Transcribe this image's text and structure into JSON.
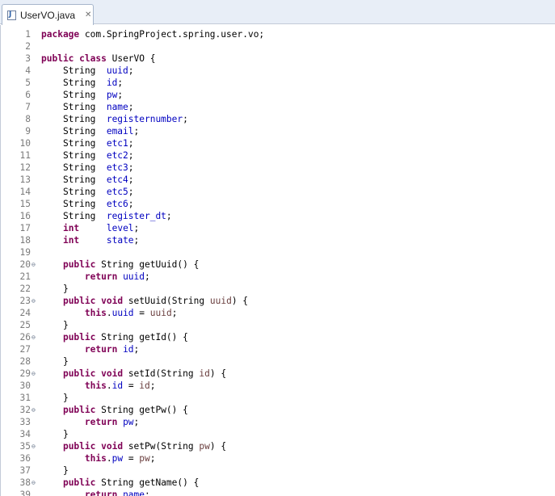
{
  "tab": {
    "title": "UserVO.java",
    "close_glyph": "✕",
    "file_type_icon": "java-file-icon"
  },
  "colors": {
    "keyword": "#7f0055",
    "field": "#0000c0",
    "parameter": "#6a3e3e",
    "text": "#000000",
    "line_number": "#7b7b7b"
  },
  "lines": [
    {
      "n": "1",
      "fold": false,
      "t": [
        [
          "k",
          "package"
        ],
        [
          "p",
          " com.SpringProject.spring.user.vo;"
        ]
      ]
    },
    {
      "n": "2",
      "fold": false,
      "t": []
    },
    {
      "n": "3",
      "fold": false,
      "t": [
        [
          "k",
          "public"
        ],
        [
          "p",
          " "
        ],
        [
          "k",
          "class"
        ],
        [
          "p",
          " UserVO {"
        ]
      ]
    },
    {
      "n": "4",
      "fold": false,
      "t": [
        [
          "p",
          "    String  "
        ],
        [
          "f",
          "uuid"
        ],
        [
          "p",
          ";"
        ]
      ]
    },
    {
      "n": "5",
      "fold": false,
      "t": [
        [
          "p",
          "    String  "
        ],
        [
          "f",
          "id"
        ],
        [
          "p",
          ";"
        ]
      ]
    },
    {
      "n": "6",
      "fold": false,
      "t": [
        [
          "p",
          "    String  "
        ],
        [
          "f",
          "pw"
        ],
        [
          "p",
          ";"
        ]
      ]
    },
    {
      "n": "7",
      "fold": false,
      "t": [
        [
          "p",
          "    String  "
        ],
        [
          "f",
          "name"
        ],
        [
          "p",
          ";"
        ]
      ]
    },
    {
      "n": "8",
      "fold": false,
      "t": [
        [
          "p",
          "    String  "
        ],
        [
          "f",
          "registernumber"
        ],
        [
          "p",
          ";"
        ]
      ]
    },
    {
      "n": "9",
      "fold": false,
      "t": [
        [
          "p",
          "    String  "
        ],
        [
          "f",
          "email"
        ],
        [
          "p",
          ";"
        ]
      ]
    },
    {
      "n": "10",
      "fold": false,
      "t": [
        [
          "p",
          "    String  "
        ],
        [
          "f",
          "etc1"
        ],
        [
          "p",
          ";"
        ]
      ]
    },
    {
      "n": "11",
      "fold": false,
      "t": [
        [
          "p",
          "    String  "
        ],
        [
          "f",
          "etc2"
        ],
        [
          "p",
          ";"
        ]
      ]
    },
    {
      "n": "12",
      "fold": false,
      "t": [
        [
          "p",
          "    String  "
        ],
        [
          "f",
          "etc3"
        ],
        [
          "p",
          ";"
        ]
      ]
    },
    {
      "n": "13",
      "fold": false,
      "t": [
        [
          "p",
          "    String  "
        ],
        [
          "f",
          "etc4"
        ],
        [
          "p",
          ";"
        ]
      ]
    },
    {
      "n": "14",
      "fold": false,
      "t": [
        [
          "p",
          "    String  "
        ],
        [
          "f",
          "etc5"
        ],
        [
          "p",
          ";"
        ]
      ]
    },
    {
      "n": "15",
      "fold": false,
      "t": [
        [
          "p",
          "    String  "
        ],
        [
          "f",
          "etc6"
        ],
        [
          "p",
          ";"
        ]
      ]
    },
    {
      "n": "16",
      "fold": false,
      "t": [
        [
          "p",
          "    String  "
        ],
        [
          "f",
          "register_dt"
        ],
        [
          "p",
          ";"
        ]
      ]
    },
    {
      "n": "17",
      "fold": false,
      "t": [
        [
          "p",
          "    "
        ],
        [
          "k",
          "int"
        ],
        [
          "p",
          "     "
        ],
        [
          "f",
          "level"
        ],
        [
          "p",
          ";"
        ]
      ]
    },
    {
      "n": "18",
      "fold": false,
      "t": [
        [
          "p",
          "    "
        ],
        [
          "k",
          "int"
        ],
        [
          "p",
          "     "
        ],
        [
          "f",
          "state"
        ],
        [
          "p",
          ";"
        ]
      ]
    },
    {
      "n": "19",
      "fold": false,
      "t": []
    },
    {
      "n": "20",
      "fold": true,
      "t": [
        [
          "p",
          "    "
        ],
        [
          "k",
          "public"
        ],
        [
          "p",
          " String getUuid() {"
        ]
      ]
    },
    {
      "n": "21",
      "fold": false,
      "t": [
        [
          "p",
          "        "
        ],
        [
          "k",
          "return"
        ],
        [
          "p",
          " "
        ],
        [
          "f",
          "uuid"
        ],
        [
          "p",
          ";"
        ]
      ]
    },
    {
      "n": "22",
      "fold": false,
      "t": [
        [
          "p",
          "    }"
        ]
      ]
    },
    {
      "n": "23",
      "fold": true,
      "t": [
        [
          "p",
          "    "
        ],
        [
          "k",
          "public"
        ],
        [
          "p",
          " "
        ],
        [
          "k",
          "void"
        ],
        [
          "p",
          " setUuid(String "
        ],
        [
          "a",
          "uuid"
        ],
        [
          "p",
          ") {"
        ]
      ]
    },
    {
      "n": "24",
      "fold": false,
      "t": [
        [
          "p",
          "        "
        ],
        [
          "k",
          "this"
        ],
        [
          "p",
          "."
        ],
        [
          "f",
          "uuid"
        ],
        [
          "p",
          " = "
        ],
        [
          "a",
          "uuid"
        ],
        [
          "p",
          ";"
        ]
      ]
    },
    {
      "n": "25",
      "fold": false,
      "t": [
        [
          "p",
          "    }"
        ]
      ]
    },
    {
      "n": "26",
      "fold": true,
      "t": [
        [
          "p",
          "    "
        ],
        [
          "k",
          "public"
        ],
        [
          "p",
          " String getId() {"
        ]
      ]
    },
    {
      "n": "27",
      "fold": false,
      "t": [
        [
          "p",
          "        "
        ],
        [
          "k",
          "return"
        ],
        [
          "p",
          " "
        ],
        [
          "f",
          "id"
        ],
        [
          "p",
          ";"
        ]
      ]
    },
    {
      "n": "28",
      "fold": false,
      "t": [
        [
          "p",
          "    }"
        ]
      ]
    },
    {
      "n": "29",
      "fold": true,
      "t": [
        [
          "p",
          "    "
        ],
        [
          "k",
          "public"
        ],
        [
          "p",
          " "
        ],
        [
          "k",
          "void"
        ],
        [
          "p",
          " setId(String "
        ],
        [
          "a",
          "id"
        ],
        [
          "p",
          ") {"
        ]
      ]
    },
    {
      "n": "30",
      "fold": false,
      "t": [
        [
          "p",
          "        "
        ],
        [
          "k",
          "this"
        ],
        [
          "p",
          "."
        ],
        [
          "f",
          "id"
        ],
        [
          "p",
          " = "
        ],
        [
          "a",
          "id"
        ],
        [
          "p",
          ";"
        ]
      ]
    },
    {
      "n": "31",
      "fold": false,
      "t": [
        [
          "p",
          "    }"
        ]
      ]
    },
    {
      "n": "32",
      "fold": true,
      "t": [
        [
          "p",
          "    "
        ],
        [
          "k",
          "public"
        ],
        [
          "p",
          " String getPw() {"
        ]
      ]
    },
    {
      "n": "33",
      "fold": false,
      "t": [
        [
          "p",
          "        "
        ],
        [
          "k",
          "return"
        ],
        [
          "p",
          " "
        ],
        [
          "f",
          "pw"
        ],
        [
          "p",
          ";"
        ]
      ]
    },
    {
      "n": "34",
      "fold": false,
      "t": [
        [
          "p",
          "    }"
        ]
      ]
    },
    {
      "n": "35",
      "fold": true,
      "t": [
        [
          "p",
          "    "
        ],
        [
          "k",
          "public"
        ],
        [
          "p",
          " "
        ],
        [
          "k",
          "void"
        ],
        [
          "p",
          " setPw(String "
        ],
        [
          "a",
          "pw"
        ],
        [
          "p",
          ") {"
        ]
      ]
    },
    {
      "n": "36",
      "fold": false,
      "t": [
        [
          "p",
          "        "
        ],
        [
          "k",
          "this"
        ],
        [
          "p",
          "."
        ],
        [
          "f",
          "pw"
        ],
        [
          "p",
          " = "
        ],
        [
          "a",
          "pw"
        ],
        [
          "p",
          ";"
        ]
      ]
    },
    {
      "n": "37",
      "fold": false,
      "t": [
        [
          "p",
          "    }"
        ]
      ]
    },
    {
      "n": "38",
      "fold": true,
      "t": [
        [
          "p",
          "    "
        ],
        [
          "k",
          "public"
        ],
        [
          "p",
          " String getName() {"
        ]
      ]
    },
    {
      "n": "39",
      "fold": false,
      "t": [
        [
          "p",
          "        "
        ],
        [
          "k",
          "return"
        ],
        [
          "p",
          " "
        ],
        [
          "f",
          "name"
        ],
        [
          "p",
          ";"
        ]
      ]
    }
  ]
}
